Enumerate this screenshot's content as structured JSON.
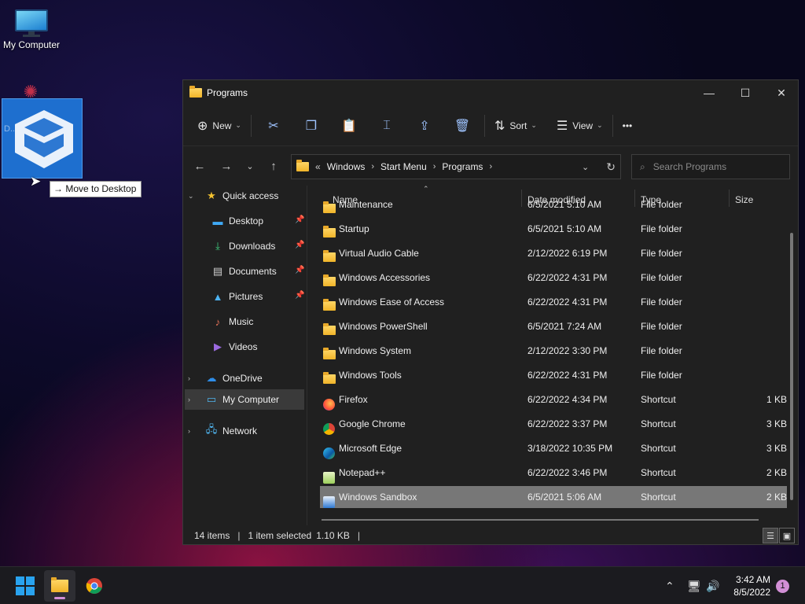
{
  "desktop": {
    "my_computer_label": "My Computer",
    "drag_tooltip": "Move to Desktop",
    "drag_under_label": "D... Wind..."
  },
  "window": {
    "title": "Programs",
    "controls": {
      "minimize": "—",
      "maximize": "☐",
      "close": "✕"
    }
  },
  "toolbar": {
    "new_label": "New",
    "sort_label": "Sort",
    "view_label": "View",
    "more": "•••"
  },
  "address": {
    "overflow": "«",
    "crumbs": [
      "Windows",
      "Start Menu",
      "Programs"
    ]
  },
  "search": {
    "placeholder": "Search Programs"
  },
  "nav": {
    "quick_access": "Quick access",
    "items": [
      {
        "label": "Desktop",
        "icon": "desktop-icon",
        "pinned": true
      },
      {
        "label": "Downloads",
        "icon": "download-icon",
        "pinned": true
      },
      {
        "label": "Documents",
        "icon": "document-icon",
        "pinned": true
      },
      {
        "label": "Pictures",
        "icon": "picture-icon",
        "pinned": true
      },
      {
        "label": "Music",
        "icon": "music-icon",
        "pinned": false
      },
      {
        "label": "Videos",
        "icon": "video-icon",
        "pinned": false
      }
    ],
    "onedrive": "OneDrive",
    "my_computer": "My Computer",
    "network": "Network"
  },
  "columns": {
    "name": "Name",
    "date": "Date modified",
    "type": "Type",
    "size": "Size"
  },
  "files": [
    {
      "name": "Maintenance",
      "date": "6/5/2021 5:10 AM",
      "type": "File folder",
      "size": "",
      "icon": "folder"
    },
    {
      "name": "Startup",
      "date": "6/5/2021 5:10 AM",
      "type": "File folder",
      "size": "",
      "icon": "folder"
    },
    {
      "name": "Virtual Audio Cable",
      "date": "2/12/2022 6:19 PM",
      "type": "File folder",
      "size": "",
      "icon": "folder"
    },
    {
      "name": "Windows Accessories",
      "date": "6/22/2022 4:31 PM",
      "type": "File folder",
      "size": "",
      "icon": "folder"
    },
    {
      "name": "Windows Ease of Access",
      "date": "6/22/2022 4:31 PM",
      "type": "File folder",
      "size": "",
      "icon": "folder"
    },
    {
      "name": "Windows PowerShell",
      "date": "6/5/2021 7:24 AM",
      "type": "File folder",
      "size": "",
      "icon": "folder"
    },
    {
      "name": "Windows System",
      "date": "2/12/2022 3:30 PM",
      "type": "File folder",
      "size": "",
      "icon": "folder"
    },
    {
      "name": "Windows Tools",
      "date": "6/22/2022 4:31 PM",
      "type": "File folder",
      "size": "",
      "icon": "folder"
    },
    {
      "name": "Firefox",
      "date": "6/22/2022 4:34 PM",
      "type": "Shortcut",
      "size": "1 KB",
      "icon": "firefox"
    },
    {
      "name": "Google Chrome",
      "date": "6/22/2022 3:37 PM",
      "type": "Shortcut",
      "size": "3 KB",
      "icon": "chrome"
    },
    {
      "name": "Microsoft Edge",
      "date": "3/18/2022 10:35 PM",
      "type": "Shortcut",
      "size": "3 KB",
      "icon": "edge"
    },
    {
      "name": "Notepad++",
      "date": "6/22/2022 3:46 PM",
      "type": "Shortcut",
      "size": "2 KB",
      "icon": "notepad"
    },
    {
      "name": "Windows Sandbox",
      "date": "6/5/2021 5:06 AM",
      "type": "Shortcut",
      "size": "2 KB",
      "icon": "sandbox",
      "selected": true
    }
  ],
  "status": {
    "items": "14 items",
    "selection": "1 item selected",
    "size": "1.10 KB"
  },
  "taskbar": {
    "time": "3:42 AM",
    "date": "8/5/2022",
    "notifications": "1"
  },
  "colors": {
    "accent": "#1e6fcf",
    "folder": "#f0b429",
    "selection": "#777777"
  }
}
